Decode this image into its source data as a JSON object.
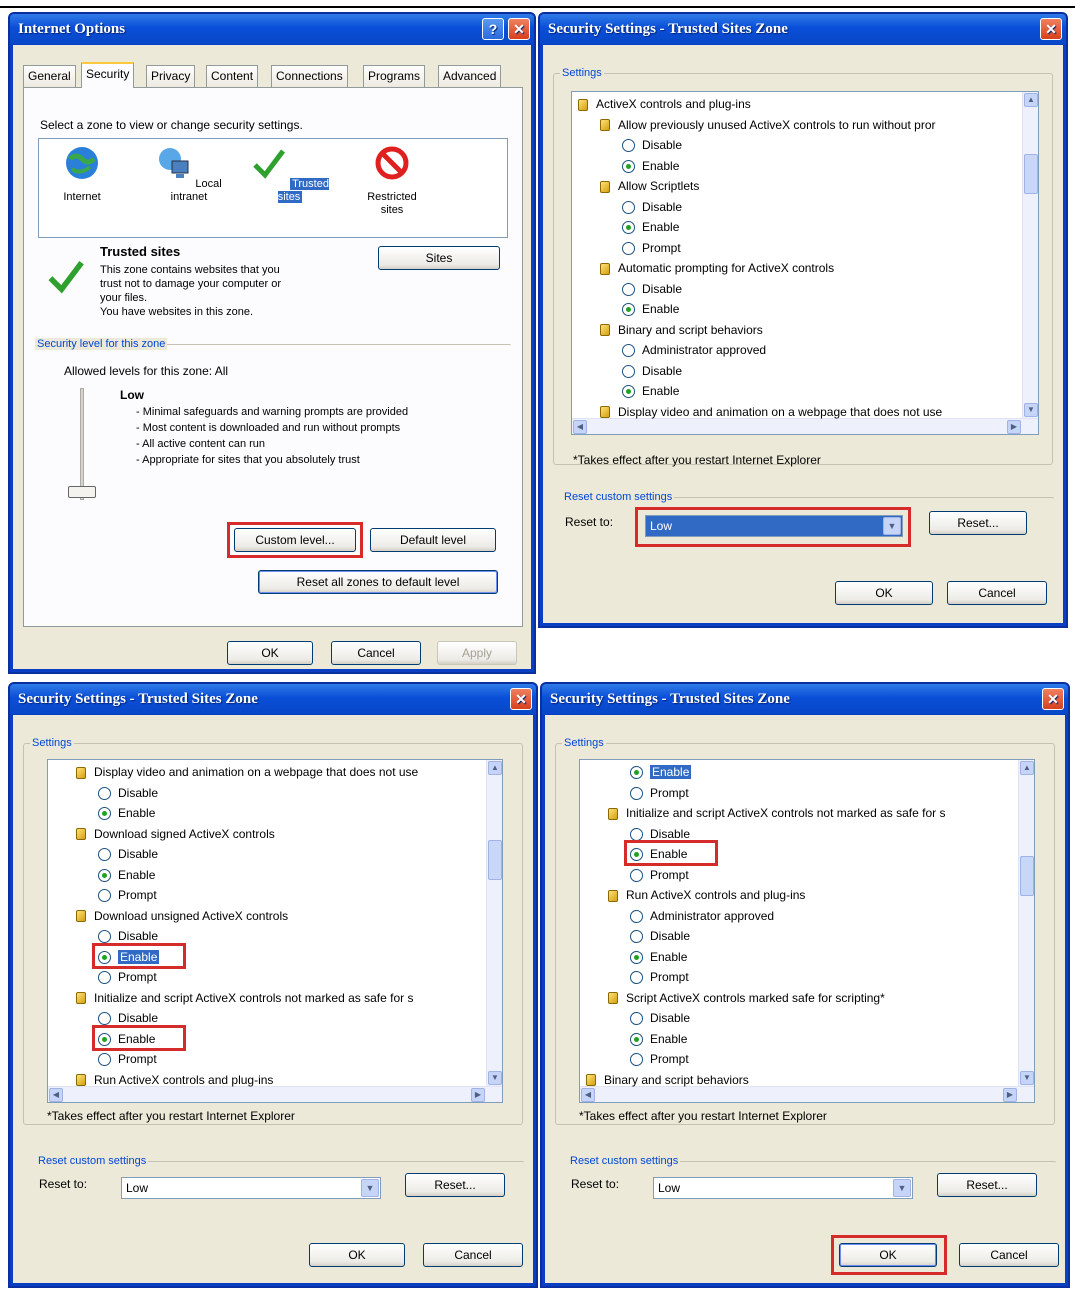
{
  "internet_options": {
    "title": "Internet Options",
    "help_glyph": "?",
    "close_glyph": "✕",
    "tabs": [
      "General",
      "Security",
      "Privacy",
      "Content",
      "Connections",
      "Programs",
      "Advanced"
    ],
    "active_tab": "Security",
    "prompt": "Select a zone to view or change security settings.",
    "zones": [
      {
        "name": "Internet",
        "icon": "globe-icon"
      },
      {
        "name": "Local intranet",
        "icon": "intranet-icon"
      },
      {
        "name": "Trusted sites",
        "icon": "checkmark-icon",
        "selected": true
      },
      {
        "name": "Restricted sites",
        "icon": "restricted-icon"
      }
    ],
    "zone_title": "Trusted sites",
    "zone_desc": [
      "This zone contains websites that you",
      "trust not to damage your computer or",
      "your files.",
      "You have websites in this zone."
    ],
    "sites_button": "Sites",
    "level_group": "Security level for this zone",
    "allowed_levels": "Allowed levels for this zone: All",
    "level_name": "Low",
    "level_points": [
      "- Minimal safeguards and warning prompts are provided",
      "- Most content is downloaded and run without prompts",
      "- All active content can run",
      "- Appropriate for sites that you absolutely trust"
    ],
    "custom_level": "Custom level...",
    "default_level": "Default level",
    "reset_all": "Reset all zones to default level",
    "ok": "OK",
    "cancel": "Cancel",
    "apply": "Apply"
  },
  "dialog_common": {
    "title": "Security Settings - Trusted Sites Zone",
    "settings_label": "Settings",
    "note": "*Takes effect after you restart Internet Explorer",
    "reset_group": "Reset custom settings",
    "reset_to": "Reset to:",
    "reset_button": "Reset...",
    "ok": "OK",
    "cancel": "Cancel",
    "close_glyph": "✕"
  },
  "dialog1": {
    "reset_value": "Low",
    "rows": [
      {
        "type": "group",
        "text": "ActiveX controls and plug-ins",
        "indent": 0
      },
      {
        "type": "item",
        "text": "Allow previously unused ActiveX controls to run without pror",
        "indent": 1
      },
      {
        "type": "radio",
        "text": "Disable",
        "indent": 2,
        "checked": false
      },
      {
        "type": "radio",
        "text": "Enable",
        "indent": 2,
        "checked": true
      },
      {
        "type": "item",
        "text": "Allow Scriptlets",
        "indent": 1
      },
      {
        "type": "radio",
        "text": "Disable",
        "indent": 2,
        "checked": false
      },
      {
        "type": "radio",
        "text": "Enable",
        "indent": 2,
        "checked": true
      },
      {
        "type": "radio",
        "text": "Prompt",
        "indent": 2,
        "checked": false
      },
      {
        "type": "item",
        "text": "Automatic prompting for ActiveX controls",
        "indent": 1
      },
      {
        "type": "radio",
        "text": "Disable",
        "indent": 2,
        "checked": false
      },
      {
        "type": "radio",
        "text": "Enable",
        "indent": 2,
        "checked": true
      },
      {
        "type": "item",
        "text": "Binary and script behaviors",
        "indent": 1
      },
      {
        "type": "radio",
        "text": "Administrator approved",
        "indent": 2,
        "checked": false
      },
      {
        "type": "radio",
        "text": "Disable",
        "indent": 2,
        "checked": false
      },
      {
        "type": "radio",
        "text": "Enable",
        "indent": 2,
        "checked": true
      },
      {
        "type": "item",
        "text": "Display video and animation on a webpage that does not use",
        "indent": 1
      }
    ]
  },
  "dialog2": {
    "reset_value": "Low",
    "rows": [
      {
        "type": "item",
        "text": "Display video and animation on a webpage that does not use",
        "indent": 1
      },
      {
        "type": "radio",
        "text": "Disable",
        "indent": 2,
        "checked": false
      },
      {
        "type": "radio",
        "text": "Enable",
        "indent": 2,
        "checked": true
      },
      {
        "type": "item",
        "text": "Download signed ActiveX controls",
        "indent": 1
      },
      {
        "type": "radio",
        "text": "Disable",
        "indent": 2,
        "checked": false
      },
      {
        "type": "radio",
        "text": "Enable",
        "indent": 2,
        "checked": true
      },
      {
        "type": "radio",
        "text": "Prompt",
        "indent": 2,
        "checked": false
      },
      {
        "type": "item",
        "text": "Download unsigned ActiveX controls",
        "indent": 1
      },
      {
        "type": "radio",
        "text": "Disable",
        "indent": 2,
        "checked": false
      },
      {
        "type": "radio",
        "text": "Enable",
        "indent": 2,
        "checked": true,
        "selected": true,
        "highlight": true
      },
      {
        "type": "radio",
        "text": "Prompt",
        "indent": 2,
        "checked": false
      },
      {
        "type": "item",
        "text": "Initialize and script ActiveX controls not marked as safe for s",
        "indent": 1
      },
      {
        "type": "radio",
        "text": "Disable",
        "indent": 2,
        "checked": false
      },
      {
        "type": "radio",
        "text": "Enable",
        "indent": 2,
        "checked": true,
        "highlight": true
      },
      {
        "type": "radio",
        "text": "Prompt",
        "indent": 2,
        "checked": false
      },
      {
        "type": "group",
        "text": "Run ActiveX controls and plug-ins",
        "indent": 1
      }
    ]
  },
  "dialog3": {
    "reset_value": "Low",
    "rows": [
      {
        "type": "radio",
        "text": "Enable",
        "indent": 2,
        "checked": true,
        "selected": true
      },
      {
        "type": "radio",
        "text": "Prompt",
        "indent": 2,
        "checked": false
      },
      {
        "type": "item",
        "text": "Initialize and script ActiveX controls not marked as safe for s",
        "indent": 1
      },
      {
        "type": "radio",
        "text": "Disable",
        "indent": 2,
        "checked": false
      },
      {
        "type": "radio",
        "text": "Enable",
        "indent": 2,
        "checked": true,
        "highlight": true
      },
      {
        "type": "radio",
        "text": "Prompt",
        "indent": 2,
        "checked": false
      },
      {
        "type": "item",
        "text": "Run ActiveX controls and plug-ins",
        "indent": 1
      },
      {
        "type": "radio",
        "text": "Administrator approved",
        "indent": 2,
        "checked": false
      },
      {
        "type": "radio",
        "text": "Disable",
        "indent": 2,
        "checked": false
      },
      {
        "type": "radio",
        "text": "Enable",
        "indent": 2,
        "checked": true
      },
      {
        "type": "radio",
        "text": "Prompt",
        "indent": 2,
        "checked": false
      },
      {
        "type": "item",
        "text": "Script ActiveX controls marked safe for scripting*",
        "indent": 1
      },
      {
        "type": "radio",
        "text": "Disable",
        "indent": 2,
        "checked": false
      },
      {
        "type": "radio",
        "text": "Enable",
        "indent": 2,
        "checked": true
      },
      {
        "type": "radio",
        "text": "Prompt",
        "indent": 2,
        "checked": false
      },
      {
        "type": "group",
        "text": "Binary and script behaviors",
        "indent": 0
      }
    ]
  }
}
